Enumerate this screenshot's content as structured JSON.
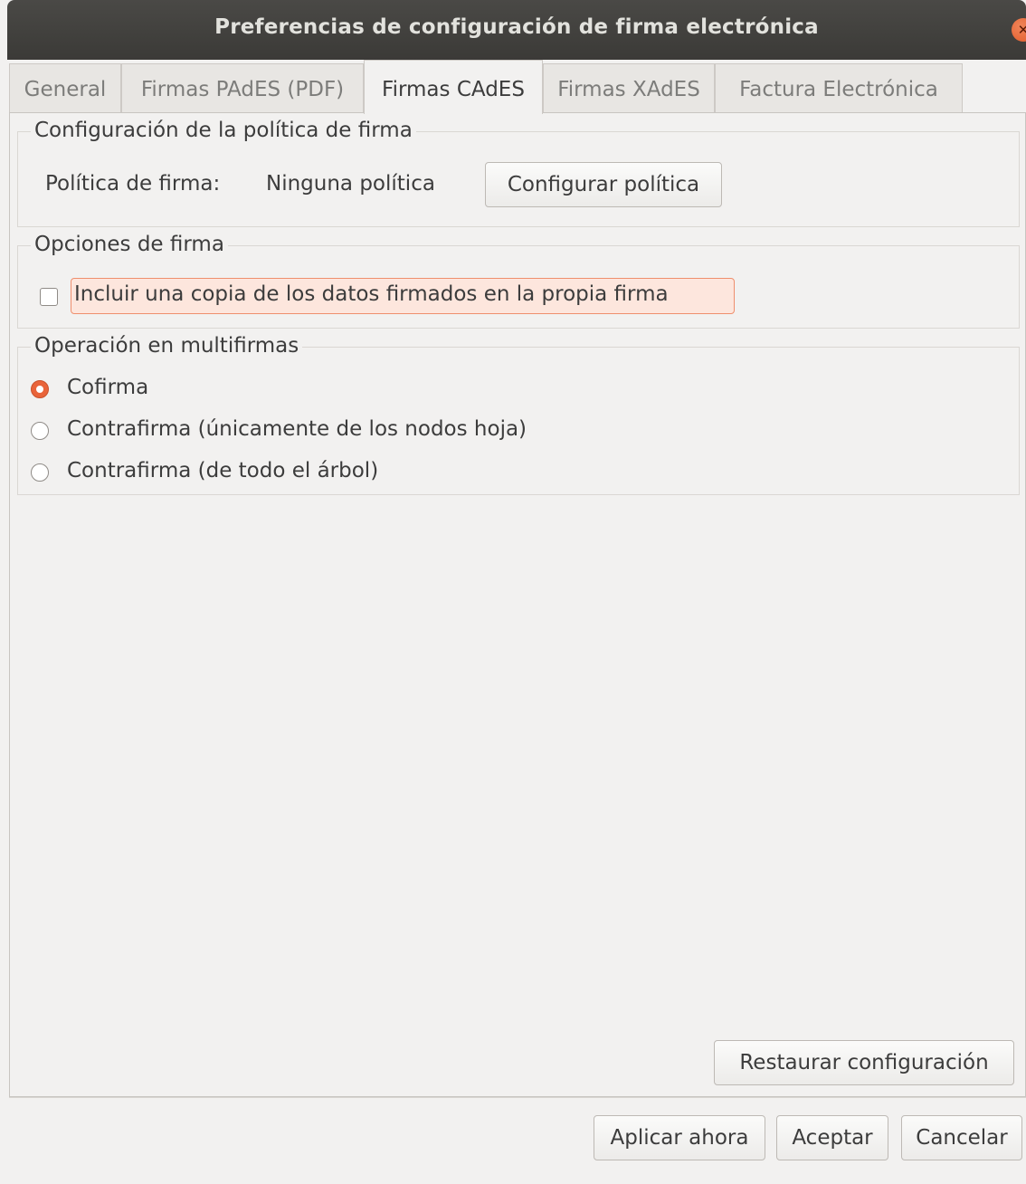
{
  "window": {
    "title": "Preferencias de configuración de firma electrónica",
    "close_icon": "close-icon"
  },
  "tabs": [
    {
      "label": "General",
      "active": false
    },
    {
      "label": "Firmas PAdES (PDF)",
      "active": false
    },
    {
      "label": "Firmas CAdES",
      "active": true
    },
    {
      "label": "Firmas XAdES",
      "active": false
    },
    {
      "label": "Factura Electrónica",
      "active": false
    }
  ],
  "policy_group": {
    "title": "Configuración de la política de firma",
    "policy_label": "Política de firma:",
    "policy_value": "Ninguna política",
    "configure_button": "Configurar política"
  },
  "options_group": {
    "title": "Opciones de firma",
    "include_data_checkbox": {
      "label": "Incluir una copia de los datos firmados en la propia firma",
      "checked": false
    }
  },
  "multisign_group": {
    "title": "Operación en multifirmas",
    "options": [
      {
        "label": "Cofirma",
        "selected": true
      },
      {
        "label": "Contrafirma (únicamente de los nodos hoja)",
        "selected": false
      },
      {
        "label": "Contrafirma (de todo el árbol)",
        "selected": false
      }
    ]
  },
  "restore_button": "Restaurar configuración",
  "footer": {
    "apply_button": "Aplicar ahora",
    "accept_button": "Aceptar",
    "cancel_button": "Cancelar"
  },
  "colors": {
    "accent": "#e9643a",
    "titlebar": "#3b3a37",
    "background": "#f2f1f0"
  }
}
